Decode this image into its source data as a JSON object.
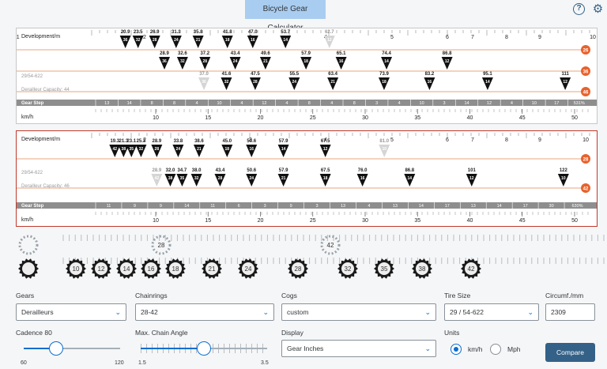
{
  "app": {
    "title": "Bicycle Gear Calculator",
    "help_icon": "help-icon",
    "settings_icon": "gear-icon"
  },
  "chart1": {
    "label_dev": "Development/m",
    "label_tire": "29/54-622",
    "label_cap": "Derailleur Capacity: 44",
    "label_step": "Gear Step",
    "label_speed": "km/h",
    "dev_ticks": [
      "2",
      "3",
      "4",
      "5",
      "6",
      "7",
      "8",
      "9",
      "10",
      "11"
    ],
    "chainrings": [
      {
        "teeth": "26",
        "markers": [
          [
            "20.9",
            "36"
          ],
          [
            "23.5",
            "32"
          ],
          [
            "26.9",
            "28"
          ],
          [
            "31.3",
            "24"
          ],
          [
            "35.8",
            "21"
          ],
          [
            "41.8",
            "18"
          ],
          [
            "47.0",
            "16"
          ],
          [
            "53.7",
            "14"
          ],
          [
            "62.7",
            "12",
            "ghost"
          ]
        ]
      },
      {
        "teeth": "36",
        "markers": [
          [
            "28.9",
            "36"
          ],
          [
            "32.6",
            "32"
          ],
          [
            "37.2",
            "28"
          ],
          [
            "43.4",
            "24"
          ],
          [
            "49.6",
            "21"
          ],
          [
            "57.9",
            "18"
          ],
          [
            "65.1",
            "16"
          ],
          [
            "74.4",
            "14"
          ],
          [
            "86.8",
            "12"
          ]
        ]
      },
      {
        "teeth": "46",
        "markers": [
          [
            "37.0",
            "36",
            "ghost"
          ],
          [
            "41.6",
            "32"
          ],
          [
            "47.5",
            "28"
          ],
          [
            "55.5",
            "24"
          ],
          [
            "63.4",
            "21"
          ],
          [
            "73.9",
            "18"
          ],
          [
            "83.2",
            "16"
          ],
          [
            "95.1",
            "14"
          ],
          [
            "111",
            "12"
          ]
        ]
      }
    ],
    "steps": [
      "13",
      "14",
      "8",
      "8",
      "4",
      "10",
      "4",
      "12",
      "4",
      "8",
      "4",
      "8",
      "3",
      "4",
      "10",
      "3",
      "14",
      "12",
      "4",
      "10",
      "17",
      "531%"
    ],
    "speed_ticks": [
      "10",
      "15",
      "20",
      "25",
      "30",
      "35",
      "40",
      "45",
      "50"
    ]
  },
  "chart2": {
    "label_dev": "Development/m",
    "label_tire": "29/54-622",
    "label_cap": "Derailleur Capacity: 46",
    "label_step": "Gear Step",
    "label_speed": "km/h",
    "dev_ticks": [
      "2",
      "3",
      "4",
      "5",
      "6",
      "7",
      "8",
      "9",
      "10"
    ],
    "chainrings": [
      {
        "teeth": "28",
        "markers": [
          [
            "19.3",
            "42"
          ],
          [
            "21.3",
            "38"
          ],
          [
            "23.1",
            "35"
          ],
          [
            "25.3",
            "32"
          ],
          [
            "28.9",
            "28"
          ],
          [
            "33.8",
            "24"
          ],
          [
            "38.6",
            "21"
          ],
          [
            "45.0",
            "18"
          ],
          [
            "50.6",
            "16"
          ],
          [
            "57.9",
            "14"
          ],
          [
            "67.5",
            "12"
          ],
          [
            "81.0",
            "10",
            "ghost"
          ]
        ]
      },
      {
        "teeth": "42",
        "markers": [
          [
            "28.9",
            "42",
            "ghost"
          ],
          [
            "32.0",
            "38"
          ],
          [
            "34.7",
            "35"
          ],
          [
            "38.0",
            "32"
          ],
          [
            "43.4",
            "28"
          ],
          [
            "50.6",
            "24"
          ],
          [
            "57.9",
            "21"
          ],
          [
            "67.5",
            "18"
          ],
          [
            "76.0",
            "16"
          ],
          [
            "86.8",
            "14"
          ],
          [
            "101",
            "12"
          ],
          [
            "122",
            "10"
          ]
        ]
      }
    ],
    "steps": [
      "11",
      "9",
      "9",
      "14",
      "11",
      "6",
      "3",
      "9",
      "3",
      "13",
      "4",
      "13",
      "14",
      "17",
      "13",
      "14",
      "17",
      "30",
      "630%"
    ],
    "speed_ticks": [
      "10",
      "15",
      "20",
      "25",
      "30",
      "35",
      "40",
      "45",
      "50"
    ]
  },
  "cogs": {
    "chainring_slots": [
      "",
      "28",
      "42"
    ],
    "cog_labels": [
      "",
      "10",
      "12",
      "14",
      "16",
      "18",
      "21",
      "24",
      "28",
      "32",
      "35",
      "38",
      "42"
    ]
  },
  "controls": {
    "gears_label": "Gears",
    "gears_value": "Derailleurs",
    "chainrings_label": "Chainrings",
    "chainrings_value": "28-42",
    "cogs_label": "Cogs",
    "cogs_value": "custom",
    "tire_label": "Tire Size",
    "tire_value": "29 / 54-622",
    "circ_label": "Circumf./mm",
    "circ_value": "2309",
    "cadence_label": "Cadence 80",
    "cadence_min": "60",
    "cadence_max": "120",
    "cadence_value": 80,
    "angle_label": "Max. Chain Angle",
    "angle_min": "1.5",
    "angle_max": "3.5",
    "angle_value": 2.5,
    "display_label": "Display",
    "display_value": "Gear Inches",
    "units_label": "Units",
    "unit_kmh": "km/h",
    "unit_mph": "Mph",
    "unit_selected": "km/h",
    "compare_label": "Compare"
  },
  "colors": {
    "accent": "#0a6ed1",
    "brand": "#346187",
    "ring": "#e8612c",
    "marker": "#111111",
    "step_bar": "#8e8e8e"
  }
}
